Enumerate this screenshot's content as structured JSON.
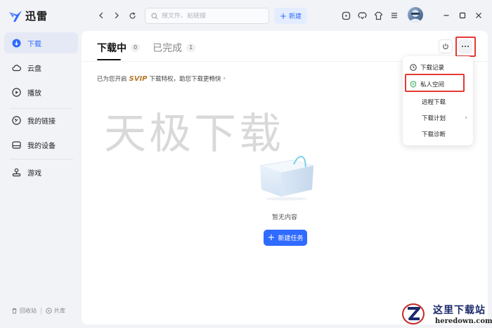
{
  "app": {
    "name": "迅雷"
  },
  "search": {
    "placeholder": "搜文件、贴链接"
  },
  "toolbar": {
    "new_label": "新建"
  },
  "sidebar": {
    "items": [
      {
        "label": "下载",
        "icon": "download-icon",
        "active": true
      },
      {
        "label": "云盘",
        "icon": "cloud-icon",
        "active": false
      },
      {
        "label": "播放",
        "icon": "play-icon",
        "active": false
      },
      {
        "label": "我的链接",
        "icon": "link-icon",
        "active": false
      },
      {
        "label": "我的设备",
        "icon": "device-icon",
        "active": false
      },
      {
        "label": "游戏",
        "icon": "gamepad-icon",
        "active": false
      }
    ],
    "bottom": {
      "recycle_label": "回收站",
      "library_label": "片库"
    }
  },
  "main": {
    "tabs": [
      {
        "label": "下载中",
        "count": "0",
        "active": true
      },
      {
        "label": "已完成",
        "count": "1",
        "active": false
      }
    ],
    "svip_banner": {
      "prefix": "已为您开启",
      "badge": "SVIP",
      "suffix": "下载特权，助您下载更畅快",
      "arrow": "›"
    },
    "watermark": "天极下载",
    "empty_text": "暂无内容",
    "create_task_label": "新建任务"
  },
  "dropdown": {
    "items": [
      {
        "label": "下载记录",
        "icon": "clock-icon"
      },
      {
        "label": "私人空间",
        "icon": "shield-icon"
      },
      {
        "label": "远程下载",
        "icon": ""
      },
      {
        "label": "下载计划",
        "icon": "",
        "submenu": true
      },
      {
        "label": "下载诊断",
        "icon": ""
      }
    ]
  },
  "site_logo": {
    "title": "这里下载站",
    "url": "heredown.com"
  },
  "colors": {
    "accent": "#2f6bff",
    "highlight": "#e53935",
    "svip": "#b57a2c"
  }
}
